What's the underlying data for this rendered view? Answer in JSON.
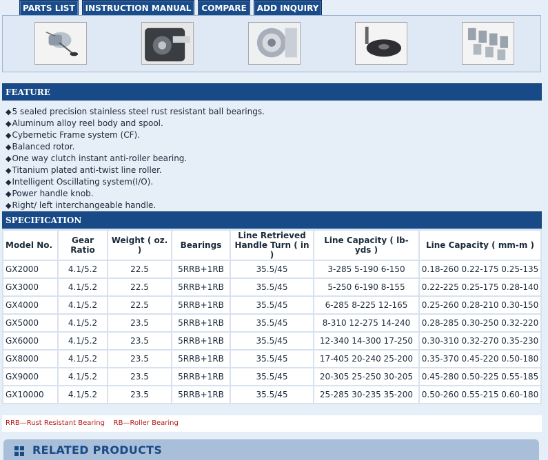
{
  "tabs": [
    "PARTS LIST",
    "INSTRUCTION MANUAL",
    "COMPARE",
    "ADD INQUIRY"
  ],
  "thumbnails": [
    "reel-photo",
    "reel-body-photo",
    "rotor-photo",
    "handle-knob-photo",
    "spools-photo"
  ],
  "feature": {
    "title": "FEATURE",
    "bullet": "◆",
    "items": [
      "5 sealed precision stainless steel rust resistant ball bearings.",
      "Aluminum alloy reel body and spool.",
      "Cybernetic Frame system (CF).",
      "Balanced rotor.",
      "One way clutch instant anti-roller bearing.",
      "Titanium plated anti-twist line roller.",
      "Intelligent Oscillating system(I/O).",
      "Power handle knob.",
      "Right/ left interchangeable handle."
    ]
  },
  "specification": {
    "title": "SPECIFICATION",
    "headers": [
      "Model No.",
      "Gear Ratio",
      "Weight ( oz. )",
      "Bearings",
      "Line Retrieved\nHandle Turn ( in )",
      "Line Capacity ( lb-yds )",
      "Line Capacity ( mm-m )"
    ],
    "rows": [
      [
        "GX2000",
        "4.1/5.2",
        "22.5",
        "5RRB+1RB",
        "35.5/45",
        "3-285 5-190 6-150",
        "0.18-260 0.22-175 0.25-135"
      ],
      [
        "GX3000",
        "4.1/5.2",
        "22.5",
        "5RRB+1RB",
        "35.5/45",
        "5-250 6-190 8-155",
        "0.22-225 0.25-175 0.28-140"
      ],
      [
        "GX4000",
        "4.1/5.2",
        "22.5",
        "5RRB+1RB",
        "35.5/45",
        "6-285 8-225 12-165",
        "0.25-260 0.28-210 0.30-150"
      ],
      [
        "GX5000",
        "4.1/5.2",
        "23.5",
        "5RRB+1RB",
        "35.5/45",
        "8-310 12-275 14-240",
        "0.28-285 0.30-250 0.32-220"
      ],
      [
        "GX6000",
        "4.1/5.2",
        "23.5",
        "5RRB+1RB",
        "35.5/45",
        "12-340 14-300 17-250",
        "0.30-310 0.32-270 0.35-230"
      ],
      [
        "GX8000",
        "4.1/5.2",
        "23.5",
        "5RRB+1RB",
        "35.5/45",
        "17-405 20-240 25-200",
        "0.35-370 0.45-220 0.50-180"
      ],
      [
        "GX9000",
        "4.1/5.2",
        "23.5",
        "5RRB+1RB",
        "35.5/45",
        "20-305 25-250 30-205",
        "0.45-280 0.50-225 0.55-185"
      ],
      [
        "GX10000",
        "4.1/5.2",
        "23.5",
        "5RRB+1RB",
        "35.5/45",
        "25-285 30-235 35-200",
        "0.50-260 0.55-215 0.60-180"
      ]
    ],
    "note": "RRB—Rust Resistant Bearing    RB—Roller Bearing"
  },
  "related": {
    "title": "RELATED PRODUCTS",
    "icon": "grid-squares-icon"
  },
  "colors": {
    "header_bar": "#174a87",
    "tab": "#1a4c8a",
    "note_text": "#b4181a",
    "page_bg": "#e6eef7"
  }
}
